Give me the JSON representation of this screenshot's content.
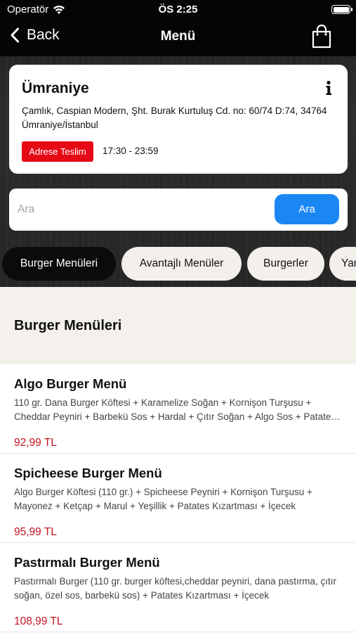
{
  "status_bar": {
    "carrier": "Operatör",
    "time": "ÖS 2:25"
  },
  "nav": {
    "back_label": "Back",
    "title": "Menü"
  },
  "branch": {
    "name": "Ümraniye",
    "address": "Çamlık, Caspian Modern, Şht. Burak Kurtuluş Cd. no: 60/74 D:74, 34764 Ümraniye/İstanbul",
    "delivery_badge": "Adrese Teslim",
    "hours": "17:30 - 23:59"
  },
  "search": {
    "placeholder": "Ara",
    "value": "",
    "button_label": "Ara"
  },
  "categories": [
    {
      "label": "Burger Menüleri",
      "active": true
    },
    {
      "label": "Avantajlı Menüler",
      "active": false
    },
    {
      "label": "Burgerler",
      "active": false
    },
    {
      "label": "Yan",
      "active": false
    }
  ],
  "section": {
    "title": "Burger Menüleri"
  },
  "products": [
    {
      "name": "Algo Burger Menü",
      "description": "110 gr. Dana Burger Köftesi + Karamelize Soğan + Kornişon Turşusu + Cheddar Peyniri + Barbekü Sos + Hardal + Çıtır Soğan + Algo Sos + Patates Kızartması + İçecek",
      "price": "92,99 TL"
    },
    {
      "name": "Spicheese Burger Menü",
      "description": "Algo Burger Köftesi (110 gr.) + Spicheese Peyniri + Kornişon Turşusu + Mayonez + Ketçap + Marul + Yeşillik + Patates Kızartması + İçecek",
      "price": "95,99 TL"
    },
    {
      "name": "Pastırmalı Burger Menü",
      "description": "Pastırmalı Burger (110 gr. burger köftesi,cheddar peyniri, dana pastırma, çıtır soğan, özel sos, barbekü sos) + Patates Kızartması + İçecek",
      "price": "108,99 TL"
    }
  ],
  "colors": {
    "accent_blue": "#1b87f4",
    "badge_red": "#e60a17",
    "price_red": "#c1121f",
    "active_chip": "#0b0b0b"
  },
  "icons": {
    "back": "chevron-left-icon",
    "cart": "shopping-bag-icon",
    "info": "info-icon",
    "wifi": "wifi-icon",
    "battery": "battery-icon"
  }
}
